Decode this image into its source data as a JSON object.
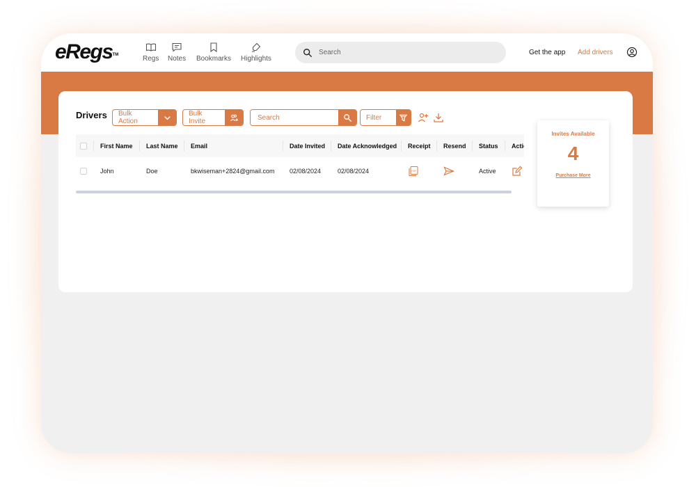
{
  "header": {
    "logo": "eRegs",
    "logo_tm": "TM",
    "nav": [
      {
        "label": "Regs",
        "icon": "book-icon"
      },
      {
        "label": "Notes",
        "icon": "note-icon"
      },
      {
        "label": "Bookmarks",
        "icon": "bookmark-icon"
      },
      {
        "label": "Highlights",
        "icon": "highlighter-icon"
      }
    ],
    "search_placeholder": "Search",
    "get_app": "Get the app",
    "add_drivers": "Add drivers",
    "account_icon": "account-circle-icon"
  },
  "drivers": {
    "title": "Drivers",
    "bulk_action": "Bulk Action",
    "bulk_invite": "Bulk Invite",
    "search_placeholder": "Search",
    "filter": "Filter",
    "columns": [
      "First Name",
      "Last Name",
      "Email",
      "Date Invited",
      "Date Acknowledged",
      "Receipt",
      "Resend",
      "Status",
      "Actio"
    ],
    "rows": [
      {
        "first_name": "John",
        "last_name": "Doe",
        "email": "bkwiseman+2824@gmail.com",
        "date_invited": "02/08/2024",
        "date_acknowledged": "02/08/2024",
        "receipt_icon": "pdf-icon",
        "resend_icon": "send-icon",
        "status": "Active",
        "action_icon": "edit-icon"
      }
    ]
  },
  "invites": {
    "label": "Invites Available",
    "count": "4",
    "purchase_link": "Purchase More"
  },
  "colors": {
    "accent": "#d97a45",
    "page_bg": "#f0f0f0",
    "scrollbar": "#c9d2e2"
  }
}
